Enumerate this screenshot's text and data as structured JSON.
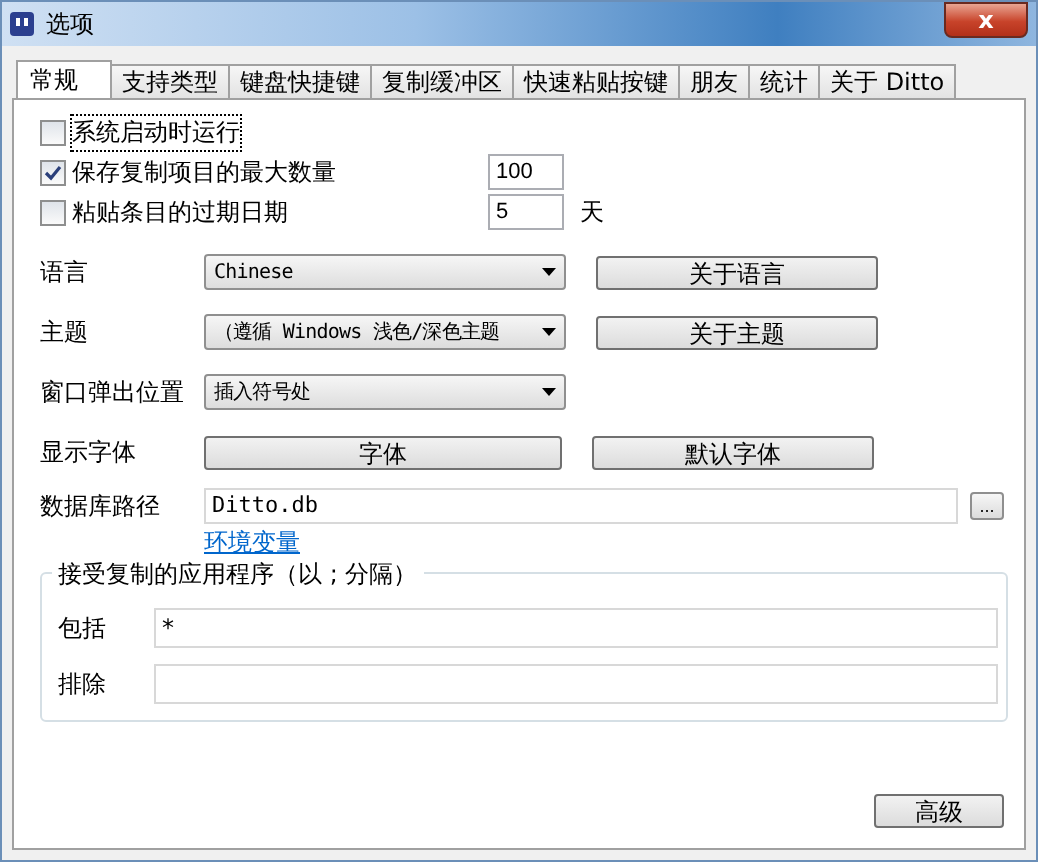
{
  "window": {
    "title": "选项",
    "close": "x"
  },
  "tabs": [
    {
      "label": "常规",
      "selected": true
    },
    {
      "label": "支持类型",
      "selected": false
    },
    {
      "label": "键盘快捷键",
      "selected": false
    },
    {
      "label": "复制缓冲区",
      "selected": false
    },
    {
      "label": "快速粘贴按键",
      "selected": false
    },
    {
      "label": "朋友",
      "selected": false
    },
    {
      "label": "统计",
      "selected": false
    },
    {
      "label": "关于 Ditto",
      "selected": false
    }
  ],
  "options": [
    {
      "label": "系统启动时运行",
      "checked": false
    },
    {
      "label": "保存复制项目的最大数量",
      "checked": true,
      "value": "100"
    },
    {
      "label": "粘贴条目的过期日期",
      "checked": false,
      "value": "5",
      "unit": "天"
    }
  ],
  "settings": [
    {
      "kind": "dropdown",
      "label": "语言",
      "value": "Chinese",
      "button": "关于语言"
    },
    {
      "kind": "dropdown",
      "label": "主题",
      "value": "（遵循 Windows 浅色/深色主题",
      "button": "关于主题"
    },
    {
      "kind": "dropdown",
      "label": "窗口弹出位置",
      "value": "插入符号处"
    },
    {
      "kind": "buttons",
      "label": "显示字体",
      "buttons": [
        "字体",
        "默认字体"
      ]
    },
    {
      "kind": "path",
      "label": "数据库路径",
      "value": "Ditto.db",
      "browse": "...",
      "link": "环境变量"
    }
  ],
  "app_filter": {
    "title": "接受复制的应用程序（以 ; 分隔）",
    "fields": [
      {
        "label": "包括",
        "value": "*"
      },
      {
        "label": "排除"
      }
    ]
  },
  "footer_button": "高级"
}
